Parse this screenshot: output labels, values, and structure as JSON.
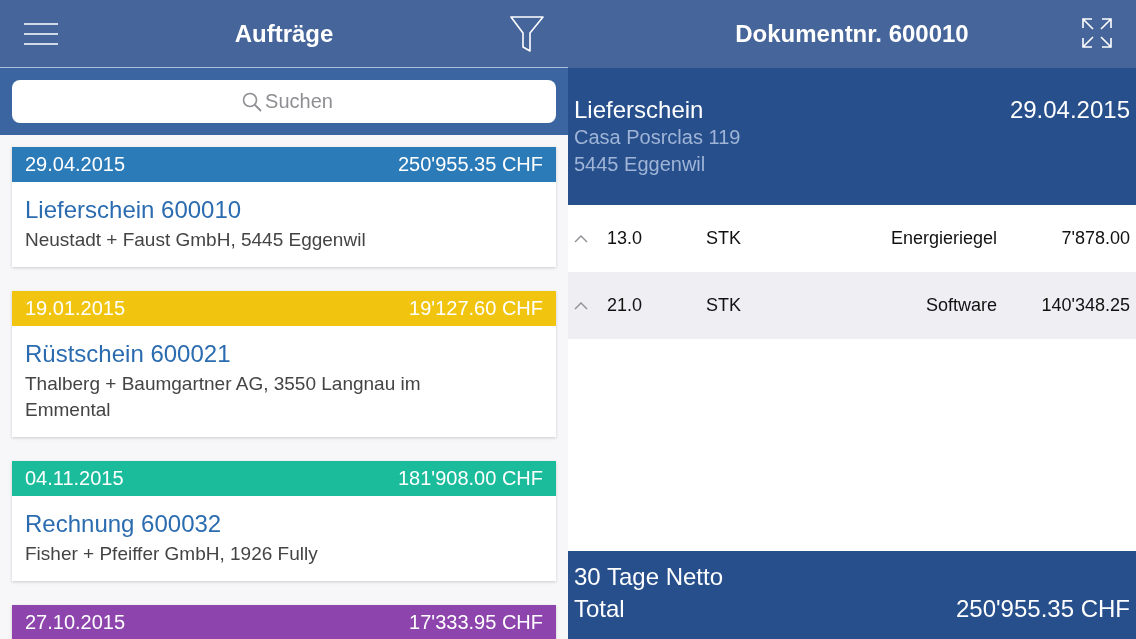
{
  "list_header": {
    "title": "Aufträge"
  },
  "search": {
    "placeholder": "Suchen"
  },
  "orders": [
    {
      "date": "29.04.2015",
      "amount": "250'955.35 CHF",
      "title": "Lieferschein 600010",
      "customer": "Neustadt + Faust GmbH, 5445 Eggenwil",
      "color": "#2b7bb9"
    },
    {
      "date": "19.01.2015",
      "amount": "19'127.60 CHF",
      "title": "Rüstschein 600021",
      "customer": "Thalberg + Baumgartner AG, 3550 Langnau im Emmental",
      "color": "#f1c40f"
    },
    {
      "date": "04.11.2015",
      "amount": "181'908.00 CHF",
      "title": "Rechnung 600032",
      "customer": "Fisher + Pfeiffer GmbH, 1926 Fully",
      "color": "#1abc9c"
    },
    {
      "date": "27.10.2015",
      "amount": "17'333.95 CHF",
      "color": "#8e44ad"
    }
  ],
  "detail_header": {
    "title": "Dokumentnr. 600010"
  },
  "document": {
    "type": "Lieferschein",
    "date": "29.04.2015",
    "address_line_1": "Casa Posrclas 119",
    "address_line_2": "5445 Eggenwil"
  },
  "positions": [
    {
      "quantity": "13.0",
      "unit": "STK",
      "article": "Energieriegel",
      "amount": "7'878.00"
    },
    {
      "quantity": "21.0",
      "unit": "STK",
      "article": "Software",
      "amount": "140'348.25"
    }
  ],
  "footer": {
    "terms": "30 Tage Netto",
    "total_label": "Total",
    "total": "250'955.35 CHF"
  }
}
